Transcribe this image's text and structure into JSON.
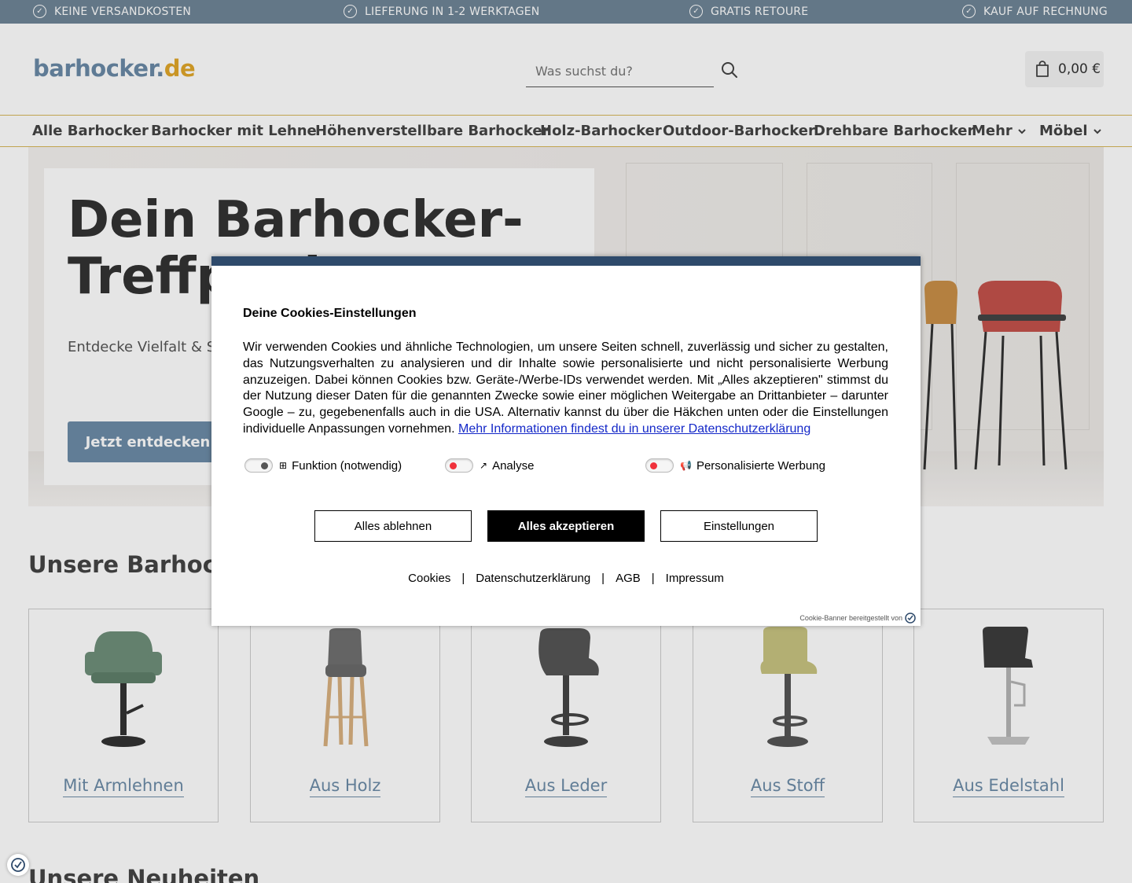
{
  "topbar": {
    "usps": [
      "KEINE VERSANDKOSTEN",
      "LIEFERUNG IN 1-2 WERKTAGEN",
      "GRATIS RETOURE",
      "KAUF AUF RECHNUNG"
    ]
  },
  "header": {
    "logo_part1": "barhocker.",
    "logo_part2": "de",
    "search_placeholder": "Was suchst du?",
    "cart_total": "0,00 €"
  },
  "nav": {
    "items": [
      "Alle Barhocker",
      "Barhocker mit Lehne",
      "Höhenverstellbare Barhocker",
      "Holz-Barhocker",
      "Outdoor-Barhocker",
      "Drehbare Barhocker",
      "Mehr",
      "Möbel"
    ]
  },
  "hero": {
    "title": "Dein Barhocker-Treffpunkt",
    "subtitle": "Entdecke Vielfalt & Stil bei uns!",
    "button": "Jetzt entdecken"
  },
  "categories": {
    "title": "Unsere Barhocker",
    "items": [
      "Mit Armlehnen",
      "Aus Holz",
      "Aus Leder",
      "Aus Stoff",
      "Aus Edelstahl"
    ]
  },
  "news": {
    "title": "Unsere Neuheiten"
  },
  "cookie": {
    "title": "Deine Cookies-Einstellungen",
    "text": "Wir verwenden Cookies und ähnliche Technologien, um unsere Seiten schnell, zuverlässig und sicher zu gestalten, das Nutzungsverhalten zu analysieren und dir Inhalte sowie personalisierte und nicht personalisierte Werbung anzuzeigen. Dabei können Cookies bzw. Geräte-/Werbe-IDs verwendet werden. Mit „Alles akzeptieren\" stimmst du der Nutzung dieser Daten für die genannten Zwecke sowie einer möglichen Weitergabe an Drittanbieter – darunter Google – zu, gegebenenfalls auch in die USA. Alternativ kannst du über die Häkchen unten oder die Einstellungen individuelle Anpassungen vornehmen.",
    "link": "Mehr Informationen findest du in unserer Datenschutzerklärung",
    "toggles": [
      {
        "label": "Funktion (notwendig)",
        "on": true
      },
      {
        "label": "Analyse",
        "on": false
      },
      {
        "label": "Personalisierte Werbung",
        "on": false
      }
    ],
    "btn_reject": "Alles ablehnen",
    "btn_accept": "Alles akzeptieren",
    "btn_settings": "Einstellungen",
    "links": [
      "Cookies",
      "Datenschutzerklärung",
      "AGB",
      "Impressum"
    ],
    "footer": "Cookie-Banner bereitgestellt von"
  },
  "colors": {
    "topbar": "#6f8597",
    "accent": "#6c8ca8",
    "gold": "#d7b75a",
    "modal_top": "#2e4a6b"
  }
}
